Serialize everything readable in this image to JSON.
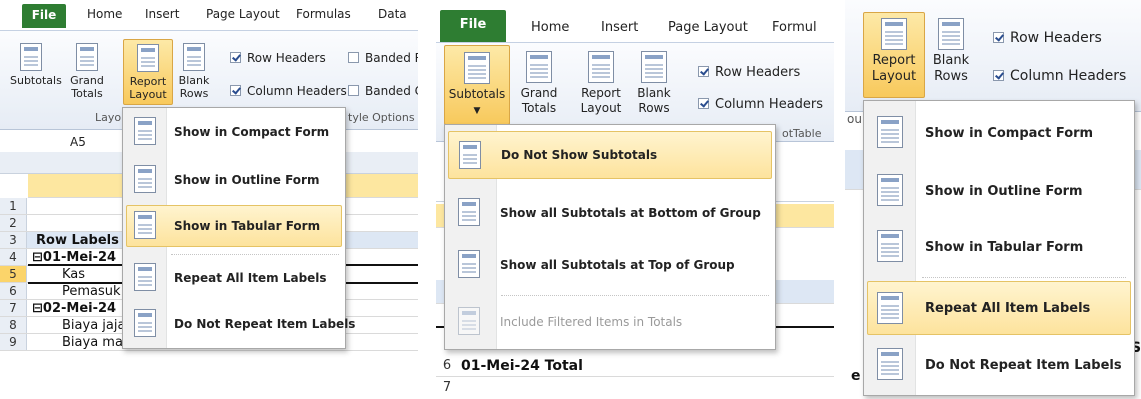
{
  "p1": {
    "tabs": [
      "File",
      "Home",
      "Insert",
      "Page Layout",
      "Formulas",
      "Data"
    ],
    "buttons": {
      "subtotals": "Subtotals",
      "grand_totals": "Grand Totals",
      "report_layout": "Report Layout",
      "blank_rows": "Blank Rows"
    },
    "checks": {
      "row_headers": "Row Headers",
      "column_headers": "Column Headers",
      "banded_rows": "Banded R",
      "banded_cols": "Banded C"
    },
    "group_layout": "Layou",
    "group_style": "tyle Options",
    "namebox": "A5",
    "menu": [
      {
        "label": "Show in Compact Form"
      },
      {
        "label": "Show in Outline Form"
      },
      {
        "label": "Show in Tabular Form"
      },
      {
        "label": "Repeat All Item Labels"
      },
      {
        "label": "Do Not Repeat Item Labels"
      }
    ],
    "rows": [
      {
        "n": "1",
        "text": ""
      },
      {
        "n": "2",
        "text": ""
      },
      {
        "n": "3",
        "text": "Row Labels"
      },
      {
        "n": "4",
        "text": "⊟01-Mei-24"
      },
      {
        "n": "5",
        "text": "Kas"
      },
      {
        "n": "6",
        "text": "Pemasuk"
      },
      {
        "n": "7",
        "text": "⊟02-Mei-24"
      },
      {
        "n": "8",
        "text": "Biaya jajan/main"
      },
      {
        "n": "9",
        "text": "Biaya makan"
      }
    ]
  },
  "p2": {
    "tabs": [
      "File",
      "Home",
      "Insert",
      "Page Layout",
      "Formul"
    ],
    "buttons": {
      "subtotals": "Subtotals",
      "grand_totals": "Grand Totals",
      "report_layout": "Report Layout",
      "blank_rows": "Blank Rows"
    },
    "checks": {
      "row_headers": "Row Headers",
      "column_headers": "Column Headers"
    },
    "group": "otTable",
    "menu": [
      {
        "label": "Do Not Show Subtotals"
      },
      {
        "label": "Show all Subtotals at Bottom of Group"
      },
      {
        "label": "Show all Subtotals at Top of Group"
      },
      {
        "label": "Include Filtered Items in Totals"
      }
    ],
    "rows": [
      {
        "n": "6",
        "text": "01-Mei-24 Total"
      },
      {
        "n": "7",
        "text": ""
      }
    ]
  },
  "p3": {
    "buttons": {
      "report_layout": "Report Layout",
      "blank_rows": "Blank Rows"
    },
    "checks": {
      "row_headers": "Row Headers",
      "column_headers": "Column Headers"
    },
    "menu": [
      {
        "label": "Show in Compact Form"
      },
      {
        "label": "Show in Outline Form"
      },
      {
        "label": "Show in Tabular Form"
      },
      {
        "label": "Repeat All Item Labels"
      },
      {
        "label": "Do Not Repeat Item Labels"
      }
    ],
    "side": {
      "a": "ou",
      "b": "e",
      "c": "S"
    }
  },
  "colors": {
    "file_tab": "#2e7d32",
    "highlight": "#fde39d",
    "ribbon": "#e6ecf5"
  }
}
